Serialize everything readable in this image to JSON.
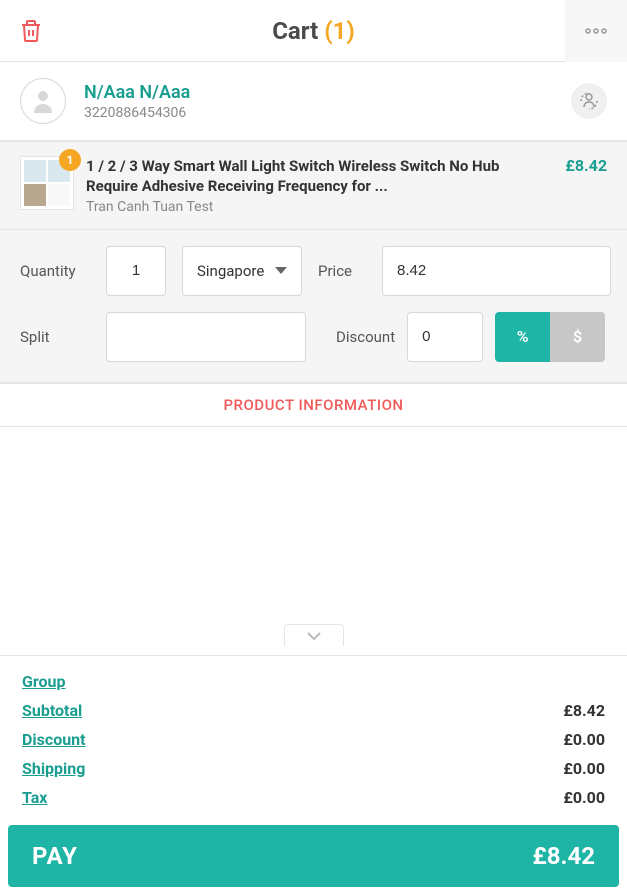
{
  "header": {
    "title": "Cart ",
    "count": "(1)"
  },
  "customer": {
    "name": "N/Aaa N/Aaa",
    "id": "3220886454306"
  },
  "product": {
    "qty_badge": "1",
    "title": "1 / 2 / 3 Way Smart Wall Light Switch Wireless Switch No Hub Require Adhesive Receiving Frequency for ...",
    "vendor": "Tran Canh Tuan Test",
    "price": "£8.42"
  },
  "form": {
    "quantity_label": "Quantity",
    "quantity_value": "1",
    "variant_value": "Singapore",
    "price_label": "Price",
    "price_value": "8.42",
    "split_label": "Split",
    "split_value": "",
    "discount_label": "Discount",
    "discount_value": "0",
    "discount_percent": "%",
    "discount_currency": "$"
  },
  "product_info_btn": "PRODUCT INFORMATION",
  "totals": {
    "group_label": "Group",
    "subtotal_label": "Subtotal",
    "subtotal_value": "£8.42",
    "discount_label": "Discount",
    "discount_value": "£0.00",
    "shipping_label": "Shipping",
    "shipping_value": "£0.00",
    "tax_label": "Tax",
    "tax_value": "£0.00"
  },
  "pay": {
    "label": "PAY",
    "amount": "£8.42"
  }
}
